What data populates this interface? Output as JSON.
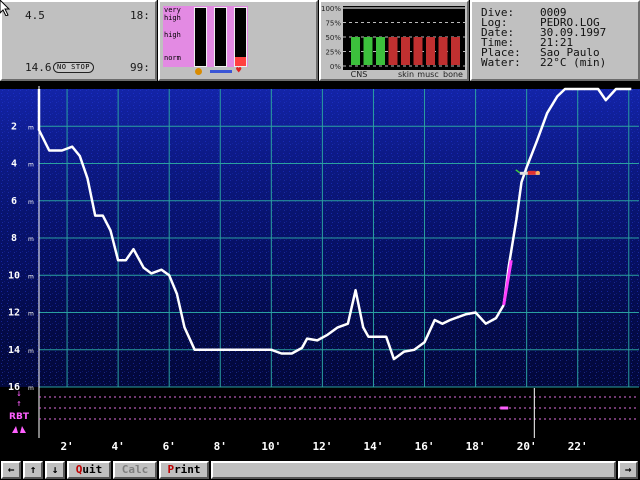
{
  "computer": {
    "ascent_speed": "4.5",
    "time_left": "18:",
    "max_depth": "14.6",
    "nostop_label": "NO STOP",
    "nostop_value": "99:"
  },
  "bars": {
    "labels": [
      "very",
      "high",
      "high",
      "norm"
    ]
  },
  "cns": {
    "ticks": [
      "100%",
      "75%",
      "50%",
      "25%",
      "0%"
    ],
    "labels": [
      "CNS",
      "skin",
      "musc",
      "bone"
    ],
    "green_count": 3,
    "red_count": 6
  },
  "info": {
    "rows": [
      {
        "label": "Dive:",
        "value": "0009"
      },
      {
        "label": "Log:",
        "value": "PEDRO.LOG"
      },
      {
        "label": "Date:",
        "value": "30.09.1997"
      },
      {
        "label": "Time:",
        "value": "21:21"
      },
      {
        "label": "Place:",
        "value": "Sao Paulo"
      },
      {
        "label": "Water:",
        "value": "22°C (min)"
      }
    ]
  },
  "chart_data": {
    "type": "line",
    "x_unit": "minutes",
    "y_unit": "m",
    "y_ticks": [
      "2",
      "4",
      "6",
      "8",
      "10",
      "12",
      "14",
      "16"
    ],
    "x_ticks": [
      "2'",
      "4'",
      "6'",
      "8'",
      "10'",
      "12'",
      "14'",
      "16'",
      "18'",
      "20'",
      "22'"
    ],
    "ylim": [
      0,
      16
    ],
    "xlim": [
      0,
      24.4
    ],
    "profile": [
      [
        0,
        0
      ],
      [
        0,
        1
      ],
      [
        0.5,
        1.3
      ],
      [
        0.9,
        2.2
      ],
      [
        1.3,
        3.3
      ],
      [
        1.8,
        3.3
      ],
      [
        2.2,
        3.1
      ],
      [
        2.5,
        3.6
      ],
      [
        2.8,
        4.8
      ],
      [
        3.1,
        6.8
      ],
      [
        3.4,
        6.8
      ],
      [
        3.7,
        7.6
      ],
      [
        4.0,
        9.2
      ],
      [
        4.3,
        9.2
      ],
      [
        4.6,
        8.6
      ],
      [
        5.0,
        9.6
      ],
      [
        5.3,
        9.9
      ],
      [
        5.7,
        9.7
      ],
      [
        6.0,
        10.0
      ],
      [
        6.3,
        11.0
      ],
      [
        6.6,
        12.8
      ],
      [
        7.0,
        14.0
      ],
      [
        10.0,
        14.0
      ],
      [
        10.4,
        14.2
      ],
      [
        10.8,
        14.2
      ],
      [
        11.2,
        13.9
      ],
      [
        11.4,
        13.4
      ],
      [
        11.8,
        13.5
      ],
      [
        12.2,
        13.2
      ],
      [
        12.6,
        12.8
      ],
      [
        13.0,
        12.6
      ],
      [
        13.3,
        10.8
      ],
      [
        13.6,
        12.8
      ],
      [
        13.8,
        13.3
      ],
      [
        14.1,
        13.3
      ],
      [
        14.5,
        13.3
      ],
      [
        14.8,
        14.5
      ],
      [
        15.2,
        14.1
      ],
      [
        15.6,
        14.0
      ],
      [
        16.0,
        13.6
      ],
      [
        16.4,
        12.4
      ],
      [
        16.7,
        12.6
      ],
      [
        17.0,
        12.4
      ],
      [
        17.6,
        12.1
      ],
      [
        18.0,
        12.0
      ],
      [
        18.4,
        12.6
      ],
      [
        18.8,
        12.3
      ],
      [
        19.1,
        11.6
      ]
    ],
    "ascent": [
      [
        19.1,
        11.6
      ],
      [
        19.3,
        9.5
      ],
      [
        19.6,
        7.0
      ],
      [
        19.8,
        5.0
      ],
      [
        20.0,
        4.2
      ],
      [
        20.4,
        2.8
      ],
      [
        20.8,
        1.3
      ],
      [
        21.2,
        0.4
      ],
      [
        21.5,
        0
      ],
      [
        22.8,
        0
      ],
      [
        23.1,
        0.6
      ],
      [
        23.5,
        0
      ],
      [
        24.1,
        0
      ]
    ],
    "violations": [
      [
        19.1,
        11.6
      ],
      [
        19.4,
        9.2
      ]
    ],
    "diver_marker": [
      20.2,
      4.5
    ],
    "rbt_label": "RBT",
    "rbt_cursor_minute": 20.3,
    "rbt_dash_minute": 19.2
  },
  "toolbar": {
    "left": "←",
    "up": "↑",
    "down": "↓",
    "quit_first": "Q",
    "quit_rest": "uit",
    "calc": "Calc",
    "print_first": "P",
    "print_rest": "rint",
    "right": "→"
  },
  "colors": {
    "panel": "#c0c0c0",
    "chart_bg": "#030a4a",
    "grid": "#2aa0a0",
    "profile": "#ffffff",
    "violation": "#ff40ff"
  }
}
